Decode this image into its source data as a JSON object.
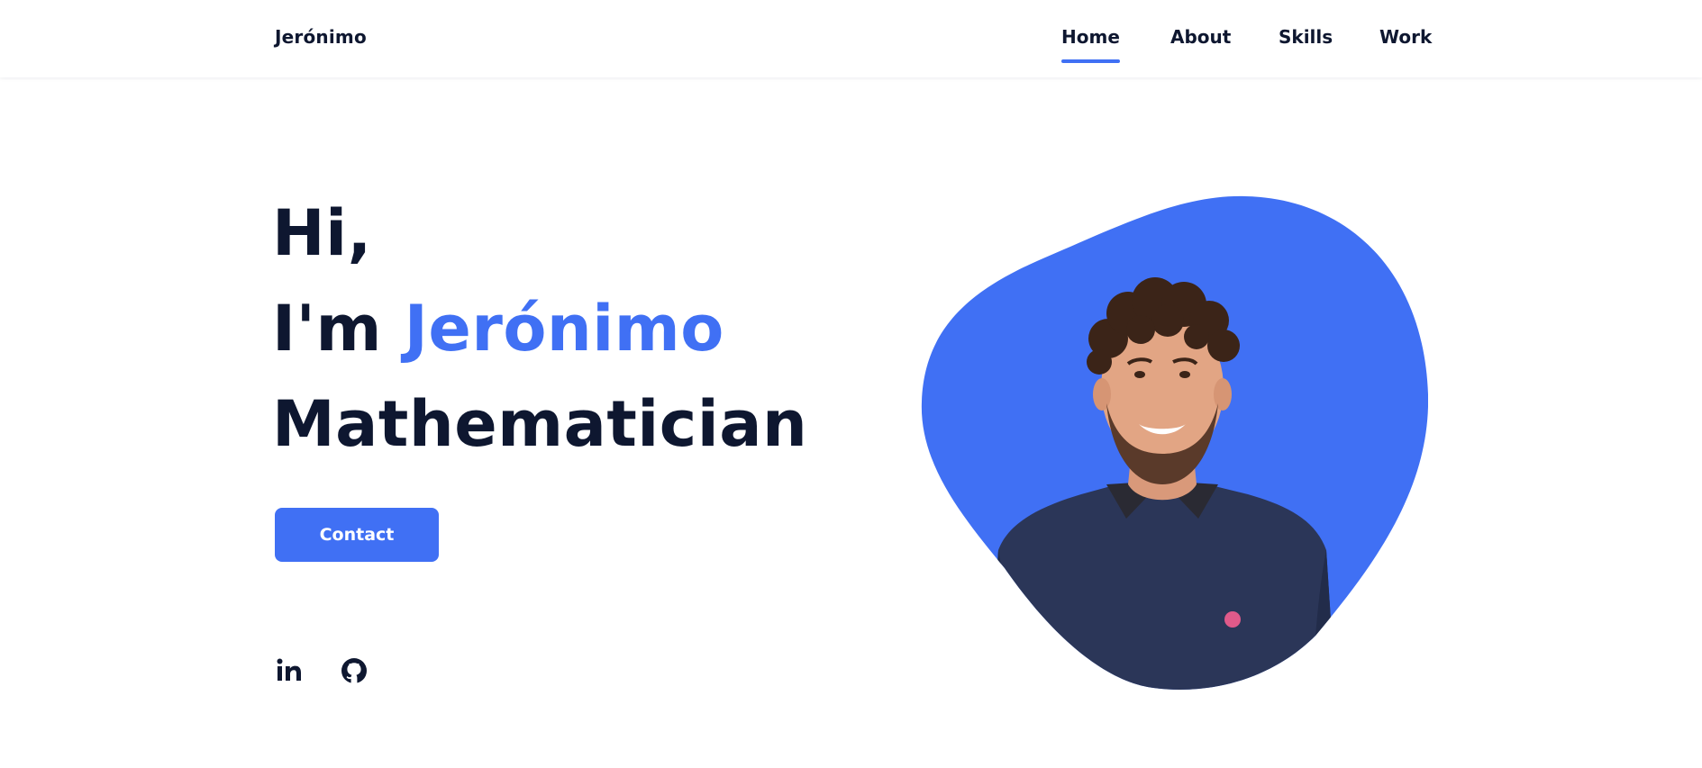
{
  "header": {
    "logo": "Jerónimo",
    "nav": [
      {
        "label": "Home",
        "active": true
      },
      {
        "label": "About",
        "active": false
      },
      {
        "label": "Skills",
        "active": false
      },
      {
        "label": "Work",
        "active": false
      }
    ]
  },
  "hero": {
    "greeting": "Hi,",
    "intro_prefix": "I'm",
    "name": "Jerónimo",
    "role": "Mathematician",
    "cta_label": "Contact"
  },
  "socials": [
    {
      "icon": "linkedin-icon"
    },
    {
      "icon": "github-icon"
    }
  ],
  "colors": {
    "accent": "#4070f4",
    "text": "#0e1730",
    "background": "#ffffff",
    "sweater": "#2b3658"
  }
}
